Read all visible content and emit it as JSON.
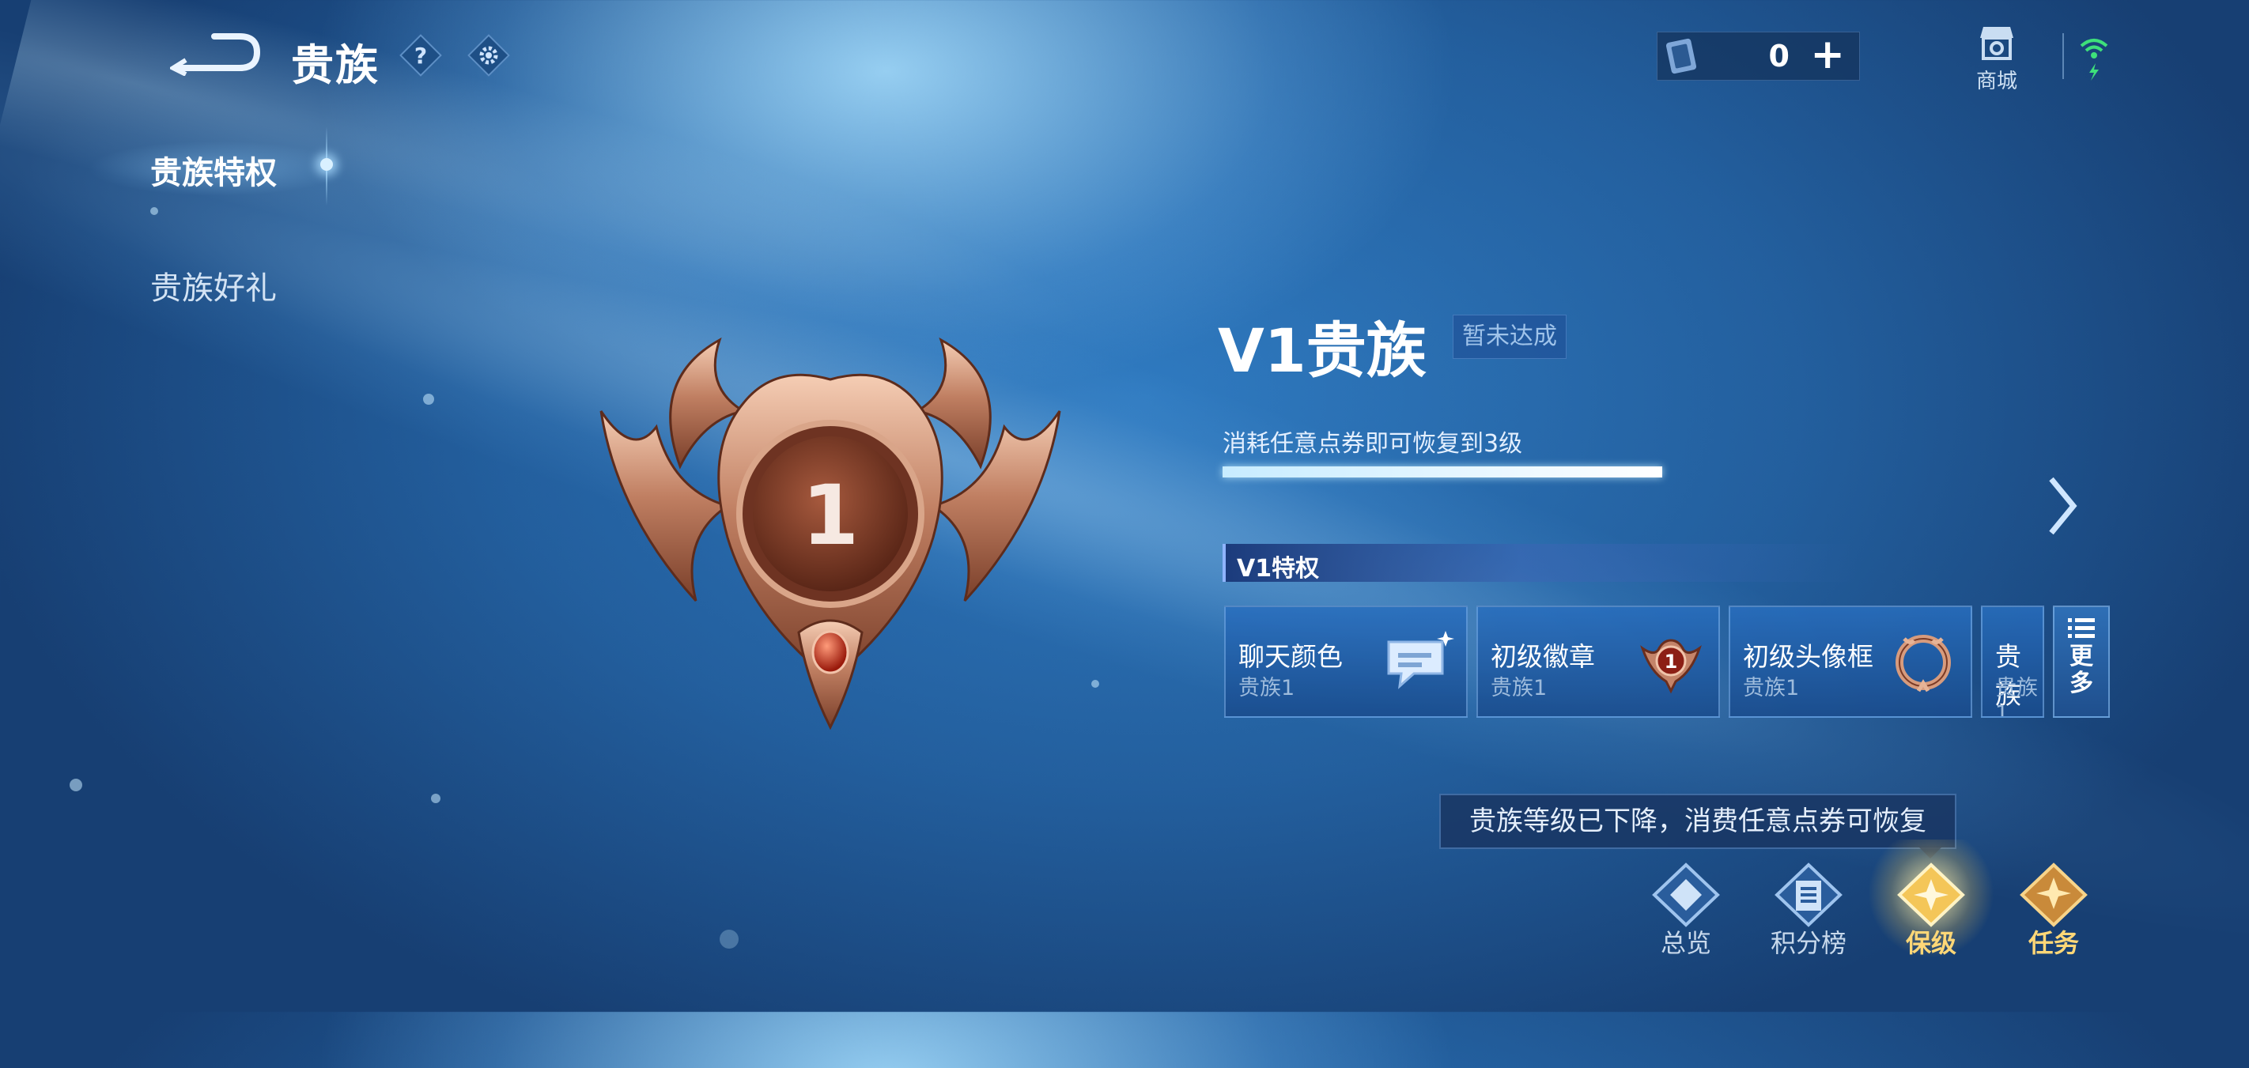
{
  "header": {
    "title": "贵族",
    "help_icon": "?",
    "settings_icon": "gear-icon",
    "currency_amount": "0",
    "currency_plus": "+",
    "shop_label": "商城"
  },
  "sidebar": {
    "items": [
      {
        "label": "贵族特权",
        "active": true
      },
      {
        "label": "贵族好礼",
        "active": false
      }
    ]
  },
  "emblem": {
    "number": "1"
  },
  "level": {
    "title": "V1贵族",
    "status": "暂未达成",
    "restore_text": "消耗任意点券即可恢复到3级",
    "progress": 1.0
  },
  "privileges": {
    "header": "V1特权",
    "cards": [
      {
        "name": "聊天颜色",
        "sub": "贵族1",
        "icon": "chat-bubble-icon"
      },
      {
        "name": "初级徽章",
        "sub": "贵族1",
        "icon": "badge-icon"
      },
      {
        "name": "初级头像框",
        "sub": "贵族1",
        "icon": "avatar-frame-icon"
      },
      {
        "name": "贵族",
        "sub": "贵族1"
      }
    ],
    "more_line1": "更",
    "more_line2": "多"
  },
  "tooltip": "贵族等级已下降，消费任意点券可恢复",
  "tabs": [
    {
      "label": "总览",
      "style": "normal"
    },
    {
      "label": "积分榜",
      "style": "normal"
    },
    {
      "label": "保级",
      "style": "gold",
      "active": true
    },
    {
      "label": "任务",
      "style": "gold"
    }
  ],
  "colors": {
    "accent_gold": "#ffd777",
    "accent_blue": "#8fb4ff",
    "background": "#235f9e"
  }
}
